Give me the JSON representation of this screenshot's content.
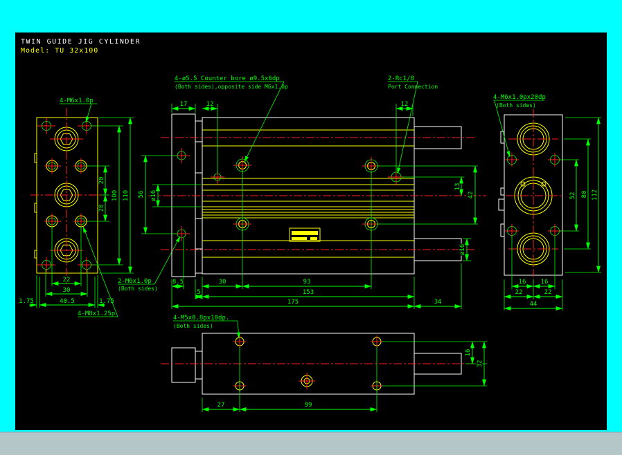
{
  "window": {
    "canvas_bg": "#000000",
    "frame_color": "#00ffff",
    "statusbar_color": "#b5c6c9"
  },
  "title_block": {
    "title": "TWIN GUIDE JIG CYLINDER",
    "model": "Model: TU 32x100"
  },
  "colors": {
    "dimension": "#00ff00",
    "outline_primary": "#ffffff",
    "outline_detail": "#ffff00",
    "centerline": "#ff2020"
  },
  "annotations": {
    "counter_bore_line1": "4-ø5.5 Counter bore ø9.5x6dp",
    "counter_bore_line2": "(Both sides),opposite side M6x1.0p",
    "port_line1": "2-Rc1/8",
    "port_line2": "Port Connection",
    "thread_end_line1": "4-M6x1.0px20dp",
    "thread_end_line2": "(Both sides)",
    "thread_front": "4-M6x1.0p",
    "thread_side_line1": "2-M6x1.0p",
    "thread_side_line2": "(Both sides)",
    "thread_front_bottom": "4-M8x1.25p",
    "thread_bottom_line1": "4-M5x0.8px10dp.",
    "thread_bottom_line2": "(Both sides)"
  },
  "dimensions": {
    "front": {
      "pitch_upper": "20",
      "pitch_lower": "20",
      "hole_span": "100",
      "height": "110",
      "hole_pitch_x": "22",
      "outer_pitch_x": "30",
      "center_width": "40.5",
      "edge_left": "1.75",
      "edge_right": "1.75"
    },
    "side": {
      "flange_thickness": "17",
      "hole_offset_left": "12",
      "port_offset": "12",
      "flange_hole_span": "56",
      "bore_dia": "ø16",
      "port_height": "13",
      "hole_row_span": "42",
      "rod_dia": "ø16",
      "flange_hole_x": "8.5",
      "first_hole_x": "30",
      "hole_pitch": "93",
      "step": "5",
      "body_length": "153",
      "overall_length": "175",
      "rod_length": "34"
    },
    "end": {
      "hole_half_left": "16",
      "hole_half_right": "16",
      "body_half_left": "22",
      "body_half_right": "22",
      "body_width": "44",
      "side_hole_span": "52",
      "rod_span": "80",
      "body_height": "112"
    },
    "bottom": {
      "first_hole_x": "27",
      "hole_pitch": "99",
      "rod_offset": "16",
      "hole_row_span": "32"
    }
  }
}
